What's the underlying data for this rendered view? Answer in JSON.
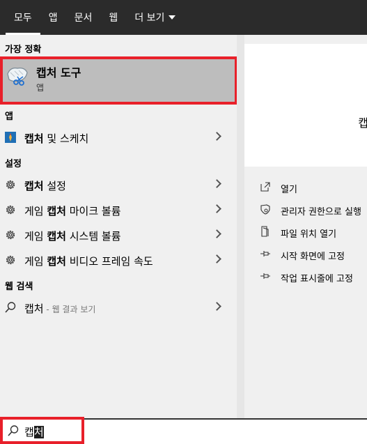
{
  "tabs": [
    {
      "label": "모두",
      "active": true
    },
    {
      "label": "앱"
    },
    {
      "label": "문서"
    },
    {
      "label": "웹"
    },
    {
      "label": "더 보기"
    }
  ],
  "sections": {
    "best_match": "가장 정확",
    "apps": "앱",
    "settings": "설정",
    "web": "웹 검색"
  },
  "best_match": {
    "title": "캡처 도구",
    "subtitle": "앱"
  },
  "apps": [
    {
      "bold": "캡처",
      "rest": " 및 스케치"
    }
  ],
  "settings": [
    {
      "pre": "",
      "bold": "캡처",
      "rest": " 설정"
    },
    {
      "pre": "게임 ",
      "bold": "캡처",
      "rest": " 마이크 볼륨"
    },
    {
      "pre": "게임 ",
      "bold": "캡처",
      "rest": " 시스템 볼륨"
    },
    {
      "pre": "게임 ",
      "bold": "캡처",
      "rest": " 비디오 프레임 속도"
    }
  ],
  "web": {
    "query": "캡처",
    "suffix": " - 웹 결과 보기"
  },
  "preview": {
    "title_fragment": "캡"
  },
  "actions": [
    {
      "label": "열기",
      "icon": "open-icon"
    },
    {
      "label": "관리자 권한으로 실행",
      "icon": "shield-icon"
    },
    {
      "label": "파일 위치 열기",
      "icon": "file-location-icon"
    },
    {
      "label": "시작 화면에 고정",
      "icon": "pin-icon"
    },
    {
      "label": "작업 표시줄에 고정",
      "icon": "pin-icon"
    }
  ],
  "search": {
    "typed": "캡",
    "selected": "처"
  },
  "colors": {
    "tabbar": "#2b2b2b",
    "highlight_border": "#e8202a",
    "best_match_bg": "#bdbdbd"
  }
}
